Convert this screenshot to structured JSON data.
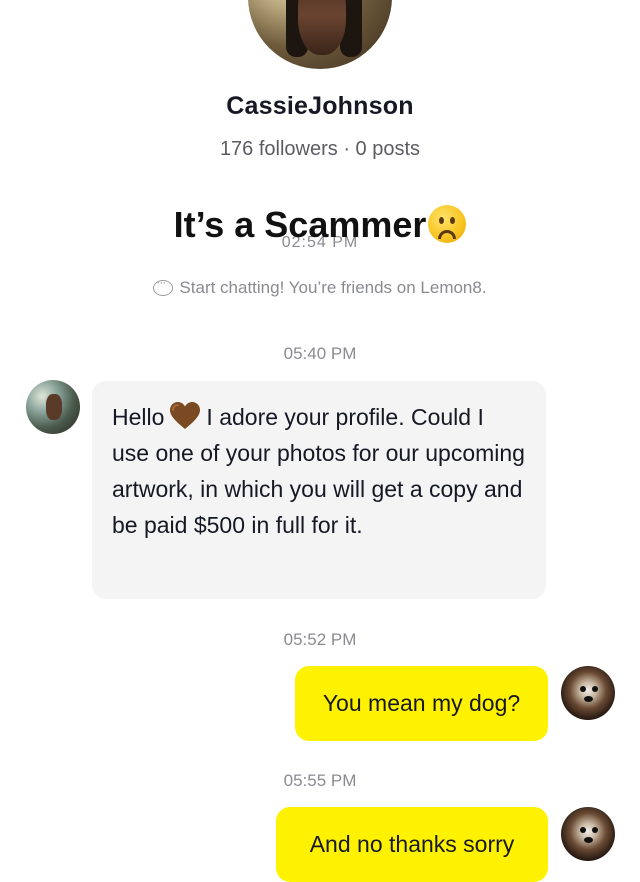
{
  "profile": {
    "name": "CassieJohnson",
    "stats": "176 followers · 0 posts"
  },
  "overlay": {
    "caption": "It’s a Scammer",
    "caption_emoji": "sad-face-emoji"
  },
  "ghost_time": "02:54 PM",
  "system_note": "Start chatting! You’re friends on Lemon8.",
  "messages": [
    {
      "time": "05:40 PM",
      "from": "them",
      "text_before": "Hello",
      "emoji": "brown-heart",
      "text_after": "I adore your profile. Could I use one of your photos for our upcoming artwork, in which you will get a copy and be paid $500 in full for it."
    },
    {
      "time": "05:52 PM",
      "from": "me",
      "text": "You mean my dog?"
    },
    {
      "time": "05:55 PM",
      "from": "me",
      "text": "And no thanks sorry"
    }
  ],
  "colors": {
    "outgoing_bubble": "#fff200",
    "incoming_bubble": "#f4f4f5",
    "muted_text": "#8a8b91"
  }
}
